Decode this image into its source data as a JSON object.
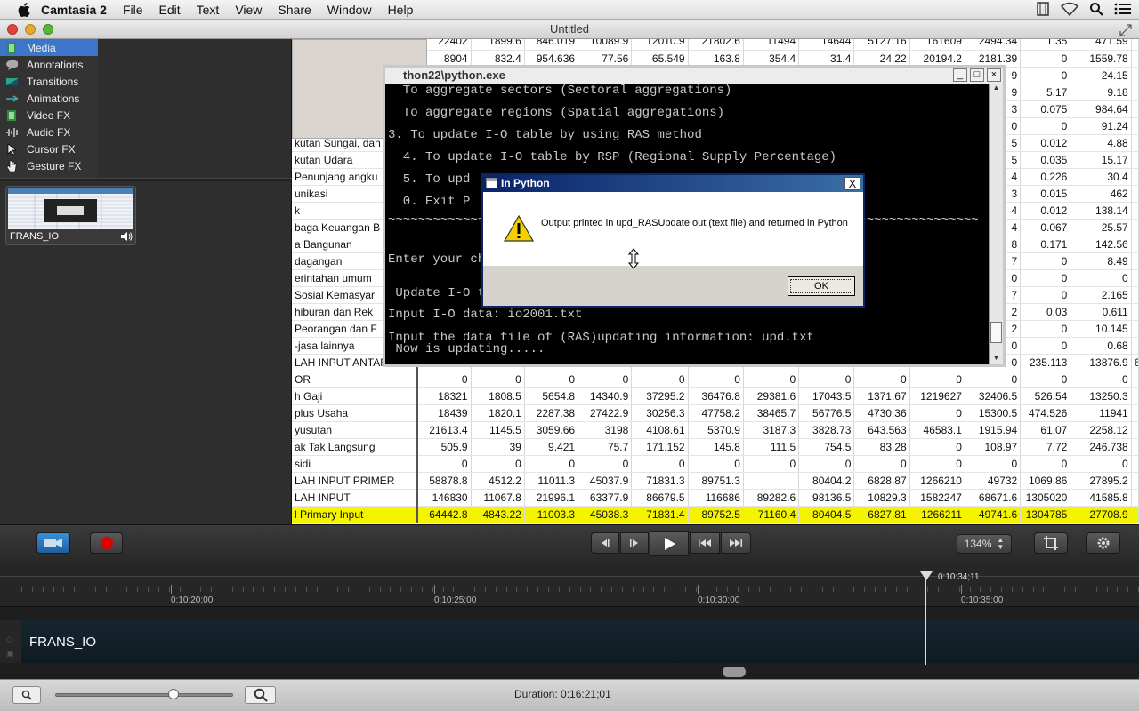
{
  "menubar": {
    "app": "Camtasia 2",
    "items": [
      "File",
      "Edit",
      "Text",
      "View",
      "Share",
      "Window",
      "Help"
    ]
  },
  "window": {
    "title": "Untitled"
  },
  "tasks": [
    {
      "label": "Media",
      "icon": "film-icon"
    },
    {
      "label": "Annotations",
      "icon": "callout-icon"
    },
    {
      "label": "Transitions",
      "icon": "transition-icon"
    },
    {
      "label": "Animations",
      "icon": "animation-icon"
    },
    {
      "label": "Video FX",
      "icon": "film-icon"
    },
    {
      "label": "Audio FX",
      "icon": "waveform-icon"
    },
    {
      "label": "Cursor FX",
      "icon": "cursor-icon"
    },
    {
      "label": "Gesture FX",
      "icon": "hand-icon"
    }
  ],
  "clip": {
    "name": "FRANS_IO"
  },
  "sheet": {
    "rows": [
      {
        "label": "",
        "values": [
          "22402",
          "1899.6",
          "846.019",
          "10089.9",
          "12010.9",
          "21802.6",
          "11494",
          "14644",
          "5127.16",
          "161609",
          "2494.34",
          "1.35",
          "471.59"
        ]
      },
      {
        "label": "",
        "values": [
          "8904",
          "832.4",
          "954.636",
          "77.56",
          "65.549",
          "163.8",
          "354.4",
          "31.4",
          "24.22",
          "20194.2",
          "2181.39",
          "0",
          "1559.78"
        ]
      },
      {
        "label": "",
        "values": [
          "",
          "",
          "",
          "",
          "",
          "",
          "",
          "",
          "",
          "",
          "9",
          "0",
          "24.15"
        ]
      },
      {
        "label": "",
        "values": [
          "",
          "",
          "",
          "",
          "",
          "",
          "",
          "",
          "",
          "",
          "9",
          "5.17",
          "9.18"
        ]
      },
      {
        "label": "",
        "values": [
          "",
          "",
          "",
          "",
          "",
          "",
          "",
          "",
          "",
          "",
          "3",
          "0.075",
          "984.64"
        ]
      },
      {
        "label": "",
        "values": [
          "",
          "",
          "",
          "",
          "",
          "",
          "",
          "",
          "",
          "",
          "0",
          "0",
          "91.24"
        ]
      },
      {
        "label": "kutan Sungai, dan",
        "values": [
          "",
          "",
          "",
          "",
          "",
          "",
          "",
          "",
          "",
          "",
          "5",
          "0.012",
          "4.88"
        ]
      },
      {
        "label": "kutan Udara",
        "values": [
          "",
          "",
          "",
          "",
          "",
          "",
          "",
          "",
          "",
          "",
          "5",
          "0.035",
          "15.17"
        ]
      },
      {
        "label": " Penunjang angku",
        "values": [
          "",
          "",
          "",
          "",
          "",
          "",
          "",
          "",
          "",
          "",
          "4",
          "0.226",
          "30.4"
        ]
      },
      {
        "label": "unikasi",
        "values": [
          "",
          "",
          "",
          "",
          "",
          "",
          "",
          "",
          "",
          "",
          "3",
          "0.015",
          "462"
        ]
      },
      {
        "label": "k",
        "values": [
          "",
          "",
          "",
          "",
          "",
          "",
          "",
          "",
          "",
          "",
          "4",
          "0.012",
          "138.14"
        ]
      },
      {
        "label": "baga Keuangan B",
        "values": [
          "",
          "",
          "",
          "",
          "",
          "",
          "",
          "",
          "",
          "",
          "4",
          "0.067",
          "25.57"
        ]
      },
      {
        "label": "a Bangunan",
        "values": [
          "",
          "",
          "",
          "",
          "",
          "",
          "",
          "",
          "",
          "",
          "8",
          "0.171",
          "142.56"
        ]
      },
      {
        "label": "dagangan",
        "values": [
          "",
          "",
          "",
          "",
          "",
          "",
          "",
          "",
          "",
          "",
          "7",
          "0",
          "8.49"
        ]
      },
      {
        "label": "erintahan umum",
        "values": [
          "",
          "",
          "",
          "",
          "",
          "",
          "",
          "",
          "",
          "",
          "0",
          "0",
          "0"
        ]
      },
      {
        "label": " Sosial Kemasyar",
        "values": [
          "",
          "",
          "",
          "",
          "",
          "",
          "",
          "",
          "",
          "",
          "7",
          "0",
          "2.165"
        ]
      },
      {
        "label": " hiburan dan Rek",
        "values": [
          "",
          "",
          "",
          "",
          "",
          "",
          "",
          "",
          "",
          "",
          "2",
          "0.03",
          "0.611"
        ]
      },
      {
        "label": " Peorangan dan F",
        "values": [
          "",
          "",
          "",
          "",
          "",
          "",
          "",
          "",
          "",
          "",
          "2",
          "0",
          "10.145"
        ]
      },
      {
        "label": "-jasa lainnya",
        "values": [
          "",
          "",
          "",
          "",
          "",
          "",
          "",
          "",
          "",
          "",
          "0",
          "0",
          "0.68"
        ]
      },
      {
        "label": "LAH INPUT ANTAR",
        "values": [
          "",
          "",
          "",
          "",
          "",
          "",
          "",
          "",
          "",
          "",
          "0",
          "235.113",
          "13876.9"
        ]
      },
      {
        "label": "OR",
        "values": [
          "0",
          "0",
          "0",
          "0",
          "0",
          "0",
          "0",
          "0",
          "0",
          "0",
          "0",
          "0",
          "0"
        ]
      },
      {
        "label": "h Gaji",
        "values": [
          "18321",
          "1808.5",
          "5654.8",
          "14340.9",
          "37295.2",
          "36476.8",
          "29381.6",
          "17043.5",
          "1371.67",
          "1219627",
          "32406.5",
          "526.54",
          "13250.3"
        ]
      },
      {
        "label": "plus Usaha",
        "values": [
          "18439",
          "1820.1",
          "2287.38",
          "27422.9",
          "30256.3",
          "47758.2",
          "38465.7",
          "56776.5",
          "4730.36",
          "0",
          "15300.5",
          "474.526",
          "11941"
        ]
      },
      {
        "label": "yusutan",
        "values": [
          "21613.4",
          "1145.5",
          "3059.66",
          "3198",
          "4108.61",
          "5370.9",
          "3187.3",
          "3828.73",
          "643.563",
          "46583.1",
          "1915.94",
          "61.07",
          "2258.12"
        ]
      },
      {
        "label": "ak Tak Langsung",
        "values": [
          "505.9",
          "39",
          "9.421",
          "75.7",
          "171.152",
          "145.8",
          "111.5",
          "754.5",
          "83.28",
          "0",
          "108.97",
          "7.72",
          "246.738"
        ]
      },
      {
        "label": "sidi",
        "values": [
          "0",
          "0",
          "0",
          "0",
          "0",
          "0",
          "0",
          "0",
          "0",
          "0",
          "0",
          "0",
          "0"
        ]
      },
      {
        "label": "LAH INPUT PRIMER",
        "values": [
          "58878.8",
          "4512.2",
          "11011.3",
          "45037.9",
          "71831.3",
          "89751.3",
          "",
          "80404.2",
          "6828.87",
          "1266210",
          "49732",
          "1069.86",
          "27895.2"
        ]
      },
      {
        "label": "LAH INPUT",
        "values": [
          "146830",
          "11067.8",
          "21996.1",
          "63377.9",
          "86679.5",
          "116686",
          "89282.6",
          "98136.5",
          "10829.3",
          "1582247",
          "68671.6",
          "1305020",
          "41585.8"
        ]
      },
      {
        "label": "l Primary Input",
        "values": [
          "64442.8",
          "4843.22",
          "11003.3",
          "45038.3",
          "71831.4",
          "89752.5",
          "71160.4",
          "80404.5",
          "6827.81",
          "1266211",
          "49741.6",
          "1304785",
          "27708.9"
        ]
      }
    ],
    "extra_cell": "6"
  },
  "console": {
    "title": "thon22\\python.exe",
    "lines": [
      "  To aggregate sectors (Sectoral aggregations)",
      "  To aggregate regions (Spatial aggregations)",
      "3. To update I-O table by using RAS method",
      "  4. To update I-O table by RSP (Regional Supply Percentage)",
      "  5. To upd",
      "  0. Exit P",
      "~~~~~~~~~~~~~~~~~~~~~~~~~~~~~~~~~~~~~~~~~~~~~~~~~~~~~~~~~~~~~~~~~~~~~~~~~~~~~~~",
      "",
      "Enter your ch",
      "",
      " Update I-O t",
      "Input I-O data: io2001.txt",
      "",
      "Input the data file of (RAS)updating information: upd.txt",
      " Now is updating....."
    ]
  },
  "dialog": {
    "title": "In Python",
    "message": "Output printed in upd_RASUpdate.out (text file) and returned in Python",
    "ok": "OK",
    "close": "X"
  },
  "controls": {
    "zoom": "134%"
  },
  "timeline": {
    "labels": [
      "0:10:20;00",
      "0:10:25;00",
      "0:10:30;00",
      "0:10:35;00"
    ],
    "playhead": "0:10:34;11",
    "track_name": "FRANS_IO",
    "duration": "Duration: 0:16:21;01"
  },
  "colors": {
    "selection": "#3d75c9",
    "highlight_row": "#f4f400",
    "record": "#e00000"
  }
}
